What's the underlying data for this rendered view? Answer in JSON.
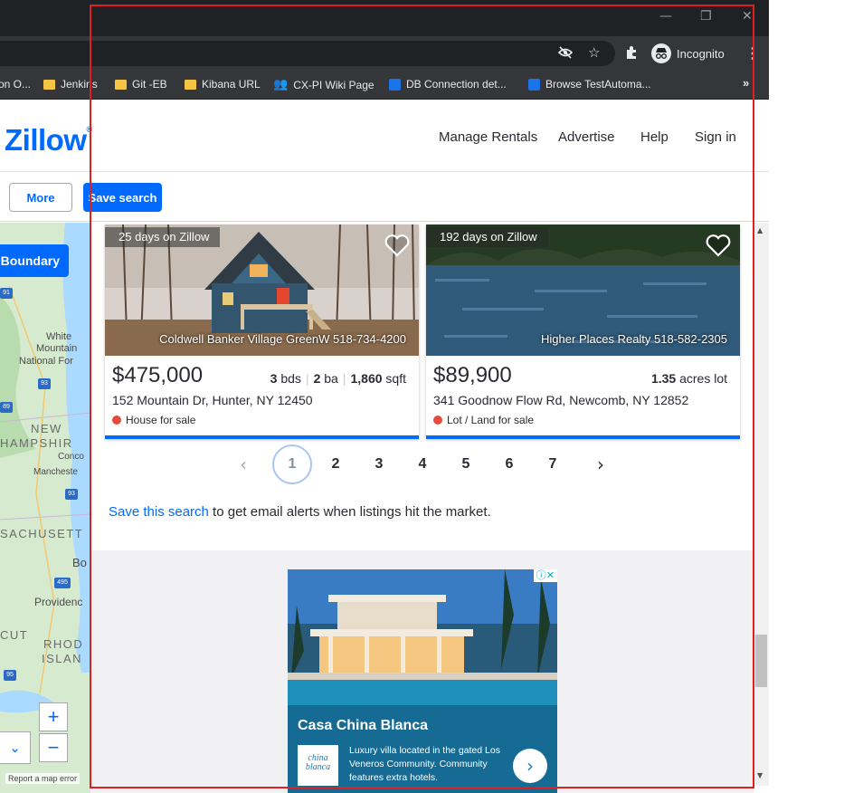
{
  "browser": {
    "incognito_label": "Incognito",
    "bookmarks": [
      {
        "label": "on O...",
        "icon": "folder-icon"
      },
      {
        "label": "Jenkins",
        "icon": "folder-icon"
      },
      {
        "label": "Git -EB",
        "icon": "folder-icon"
      },
      {
        "label": "Kibana URL",
        "icon": "folder-icon"
      },
      {
        "label": "CX-PI Wiki Page",
        "icon": "people-icon"
      },
      {
        "label": "DB Connection det...",
        "icon": "bookmark-blue-icon"
      },
      {
        "label": "Browse TestAutoma...",
        "icon": "bookmark-blue-icon"
      }
    ],
    "more_bookmarks": "»"
  },
  "header": {
    "logo": "Zillow",
    "logo_mark": "®",
    "nav": [
      "Manage Rentals",
      "Advertise",
      "Help",
      "Sign in"
    ]
  },
  "filters": {
    "more_label": "More",
    "save_search_label": "Save search"
  },
  "map": {
    "boundary_label": "Boundary",
    "zoom_in": "+",
    "zoom_out": "−",
    "report_error": "Report a map error",
    "labels": {
      "white_mountain": "White",
      "mountain": "Mountain",
      "national_forest": "National For",
      "new": "NEW",
      "hampshire": "HAMPSHIR",
      "concord": "Conco",
      "manchester": "Mancheste",
      "massachusetts": "SACHUSETT",
      "boston": "Bo",
      "providence": "Providenc",
      "connecticut": "CUT",
      "rhode": "RHOD",
      "island": "ISLAN"
    },
    "shields": [
      "91",
      "93",
      "89",
      "93",
      "495",
      "95"
    ]
  },
  "listings": [
    {
      "days_on": "25 days on Zillow",
      "broker": "Coldwell Banker Village GreenW 518-734-4200",
      "price": "$475,000",
      "beds_num": "3",
      "beds_unit": "bds",
      "baths_num": "2",
      "baths_unit": "ba",
      "sqft_num": "1,860",
      "sqft_unit": "sqft",
      "address": "152 Mountain Dr, Hunter, NY 12450",
      "status": "House for sale"
    },
    {
      "days_on": "192 days on Zillow",
      "broker": "Higher Places Realty 518-582-2305",
      "price": "$89,900",
      "lot_num": "1.35",
      "lot_unit": "acres lot",
      "address": "341 Goodnow Flow Rd, Newcomb, NY 12852",
      "status": "Lot / Land for sale"
    }
  ],
  "pagination": {
    "pages": [
      "1",
      "2",
      "3",
      "4",
      "5",
      "6",
      "7"
    ],
    "current": "1"
  },
  "save_prompt": {
    "link": "Save this search",
    "rest": " to get email alerts when listings hit the market."
  },
  "ad": {
    "title": "Casa China Blanca",
    "logo_text": "china blanca",
    "body": "Luxury villa located in the gated Los Veneros Community. Community features extra hotels.",
    "tag": "ⓘ✕"
  },
  "colors": {
    "brand": "#006aff",
    "sold_dot": "#e84a3c",
    "annotation_box": "#e02020"
  }
}
